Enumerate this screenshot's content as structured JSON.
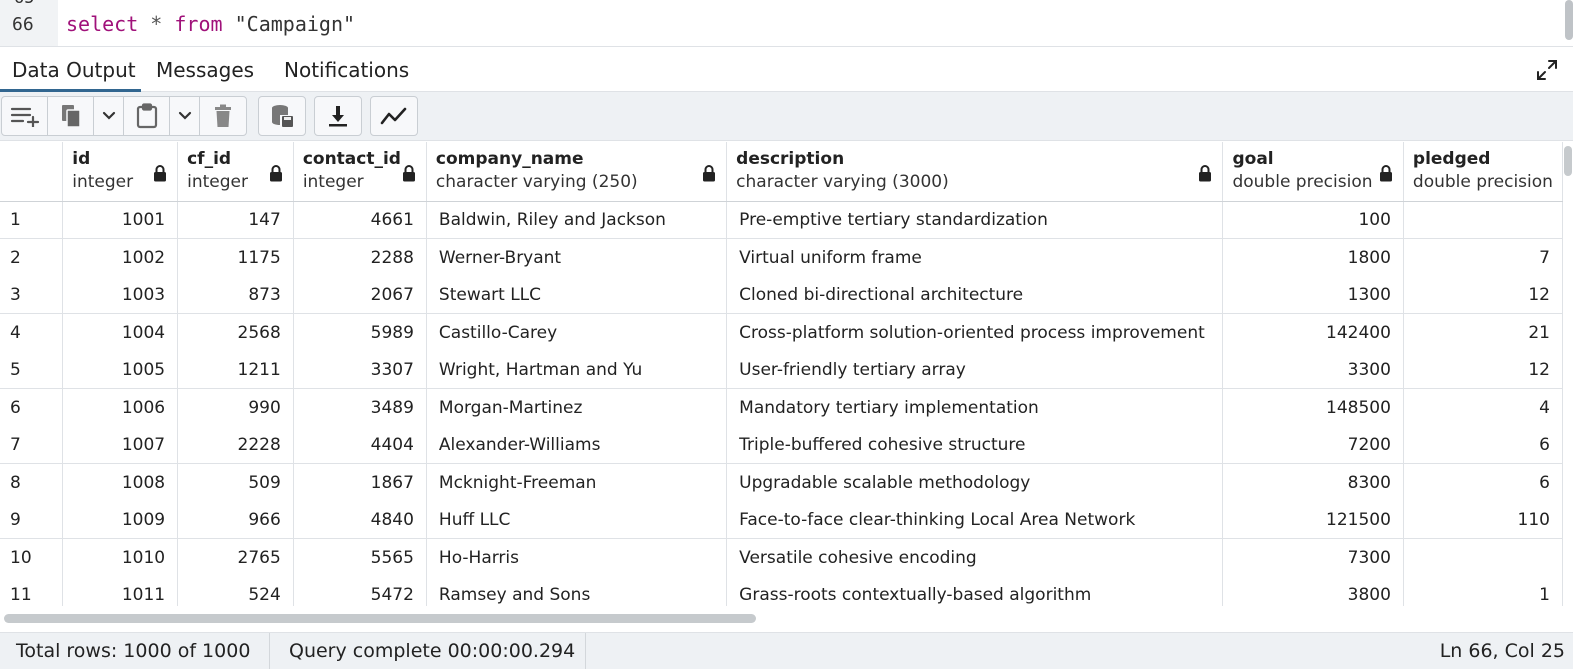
{
  "editor": {
    "prev_line_number": "65",
    "line_number": "66",
    "code": {
      "kw1": "select",
      "star": "*",
      "kw2": "from",
      "table": "\"Campaign\""
    }
  },
  "tabs": {
    "data_output": "Data Output",
    "messages": "Messages",
    "notifications": "Notifications",
    "active": "Data Output"
  },
  "toolbar": {
    "icons": [
      "add-row-icon",
      "copy-icon",
      "chevron-down-icon",
      "paste-icon",
      "chevron-down-icon",
      "delete-icon",
      "save-data-icon",
      "download-icon",
      "graph-icon"
    ]
  },
  "grid": {
    "columns": [
      {
        "name": "id",
        "type": "integer"
      },
      {
        "name": "cf_id",
        "type": "integer"
      },
      {
        "name": "contact_id",
        "type": "integer"
      },
      {
        "name": "company_name",
        "type": "character varying (250)"
      },
      {
        "name": "description",
        "type": "character varying (3000)"
      },
      {
        "name": "goal",
        "type": "double precision"
      },
      {
        "name": "pledged",
        "type": "double precision"
      }
    ],
    "rows": [
      [
        "1",
        "1001",
        "147",
        "4661",
        "Baldwin, Riley and Jackson",
        "Pre-emptive tertiary standardization",
        "100",
        ""
      ],
      [
        "2",
        "1002",
        "1175",
        "2288",
        "Werner-Bryant",
        "Virtual uniform frame",
        "1800",
        "7"
      ],
      [
        "3",
        "1003",
        "873",
        "2067",
        "Stewart LLC",
        "Cloned bi-directional architecture",
        "1300",
        "12"
      ],
      [
        "4",
        "1004",
        "2568",
        "5989",
        "Castillo-Carey",
        "Cross-platform solution-oriented process improvement",
        "142400",
        "21"
      ],
      [
        "5",
        "1005",
        "1211",
        "3307",
        "Wright, Hartman and Yu",
        "User-friendly tertiary array",
        "3300",
        "12"
      ],
      [
        "6",
        "1006",
        "990",
        "3489",
        "Morgan-Martinez",
        "Mandatory tertiary implementation",
        "148500",
        "4"
      ],
      [
        "7",
        "1007",
        "2228",
        "4404",
        "Alexander-Williams",
        "Triple-buffered cohesive structure",
        "7200",
        "6"
      ],
      [
        "8",
        "1008",
        "509",
        "1867",
        "Mcknight-Freeman",
        "Upgradable scalable methodology",
        "8300",
        "6"
      ],
      [
        "9",
        "1009",
        "966",
        "4840",
        "Huff LLC",
        "Face-to-face clear-thinking Local Area Network",
        "121500",
        "110"
      ],
      [
        "10",
        "1010",
        "2765",
        "5565",
        "Ho-Harris",
        "Versatile cohesive encoding",
        "7300",
        ""
      ],
      [
        "11",
        "1011",
        "524",
        "5472",
        "Ramsey and Sons",
        "Grass-roots contextually-based algorithm",
        "3800",
        "1"
      ]
    ]
  },
  "status": {
    "total_rows": "Total rows: 1000 of 1000",
    "query": "Query complete 00:00:00.294",
    "cursor": "Ln 66, Col 25"
  },
  "colors": {
    "accent": "#326690",
    "keyword": "#a0117a",
    "toolbar_bg": "#eef1f4"
  }
}
